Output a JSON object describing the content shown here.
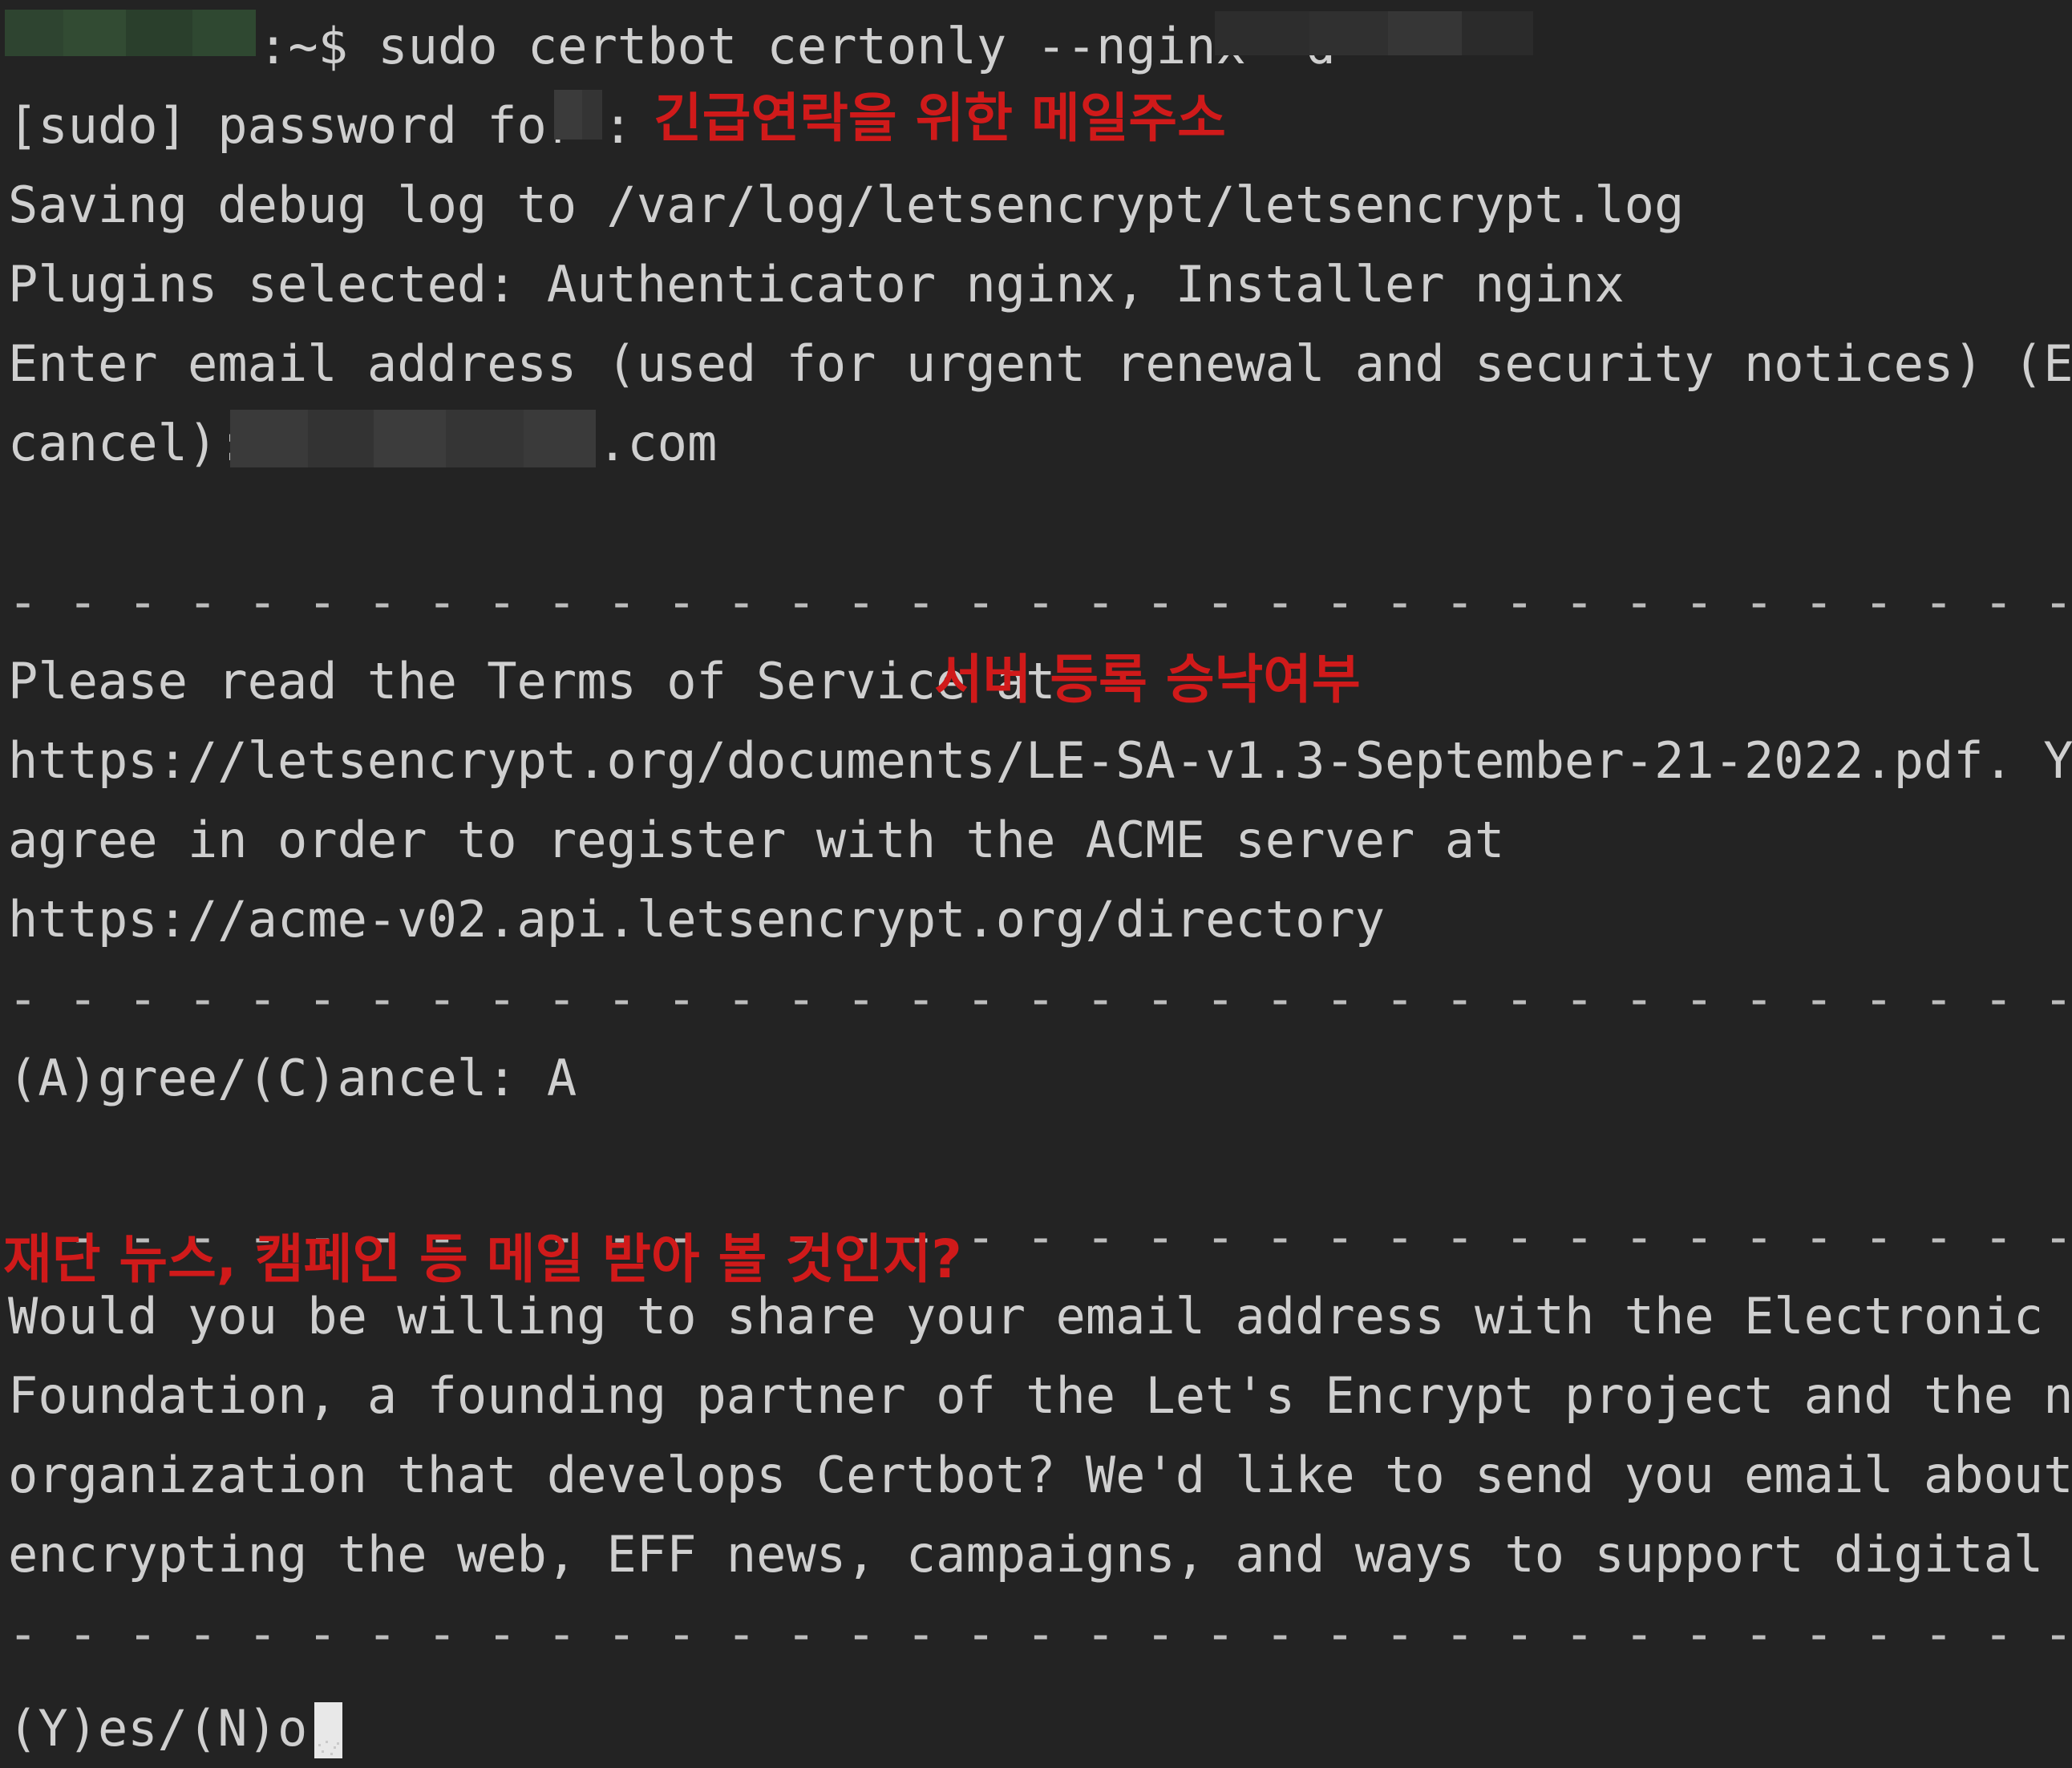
{
  "terminal": {
    "background_color": "#232323",
    "foreground_color": "#cfcfcf",
    "annotation_color": "#d01a1a",
    "cursor_color": "#e8e8e8",
    "prompt_suffix": ":~$ sudo certbot certonly --nginx -d",
    "lines": [
      {
        "id": "prompt",
        "text": ":~$ sudo certbot certonly --nginx -d"
      },
      {
        "id": "sudo_password",
        "text": "[sudo] password for"
      },
      {
        "id": "sudo_password_tail",
        "text": ":"
      },
      {
        "id": "saving_debug_log",
        "text": "Saving debug log to /var/log/letsencrypt/letsencrypt.log"
      },
      {
        "id": "plugins_selected",
        "text": "Plugins selected: Authenticator nginx, Installer nginx"
      },
      {
        "id": "enter_email",
        "text": "Enter email address (used for urgent renewal and security notices) (Enter 'c' to"
      },
      {
        "id": "cancel_prompt",
        "text": "cancel):"
      },
      {
        "id": "email_tld",
        "text": ".com"
      },
      {
        "id": "separator_1",
        "text": "- - - - - - - - - - - - - - - - - - - - - - - - - - - - - - - - - - - - - - - -"
      },
      {
        "id": "tos_intro",
        "text": "Please read the Terms of Service at"
      },
      {
        "id": "tos_url",
        "text": "https://letsencrypt.org/documents/LE-SA-v1.3-September-21-2022.pdf. You must"
      },
      {
        "id": "agree_line",
        "text": "agree in order to register with the ACME server at"
      },
      {
        "id": "acme_url",
        "text": "https://acme-v02.api.letsencrypt.org/directory"
      },
      {
        "id": "separator_2",
        "text": "- - - - - - - - - - - - - - - - - - - - - - - - - - - - - - - - - - - - - - - -"
      },
      {
        "id": "agree_cancel_prompt",
        "text": "(A)gree/(C)ancel: A"
      },
      {
        "id": "separator_3",
        "text": "- - - - - - - - - - - - - - - - - - - - - - - - - - - - - - - - - - - - - - - -"
      },
      {
        "id": "eff_line_1",
        "text": "Would you be willing to share your email address with the Electronic Frontier"
      },
      {
        "id": "eff_line_2",
        "text": "Foundation, a founding partner of the Let's Encrypt project and the non-profit"
      },
      {
        "id": "eff_line_3",
        "text": "organization that develops Certbot? We'd like to send you email about our work"
      },
      {
        "id": "eff_line_4",
        "text": "encrypting the web, EFF news, campaigns, and ways to support digital freedom."
      },
      {
        "id": "separator_4",
        "text": "- - - - - - - - - - - - - - - - - - - - - - - - - - - - - - - - - - - - - - - -"
      },
      {
        "id": "yes_no_prompt",
        "text": "(Y)es/(N)o:"
      }
    ],
    "annotations": [
      {
        "id": "annot_email",
        "text": "긴급연락을 위한 메일주소"
      },
      {
        "id": "annot_server",
        "text": "서버 등록 승낙여부"
      },
      {
        "id": "annot_news",
        "text": "재단 뉴스, 캠페인 등 메일 받아 볼 것인지?"
      }
    ],
    "redactions": [
      {
        "id": "redaction-username-host",
        "kind": "green-mosaic"
      },
      {
        "id": "redaction-domain",
        "kind": "gray-mosaic"
      },
      {
        "id": "redaction-sudo-user",
        "kind": "gray-mosaic"
      },
      {
        "id": "redaction-email-local",
        "kind": "gray-mosaic"
      }
    ]
  }
}
